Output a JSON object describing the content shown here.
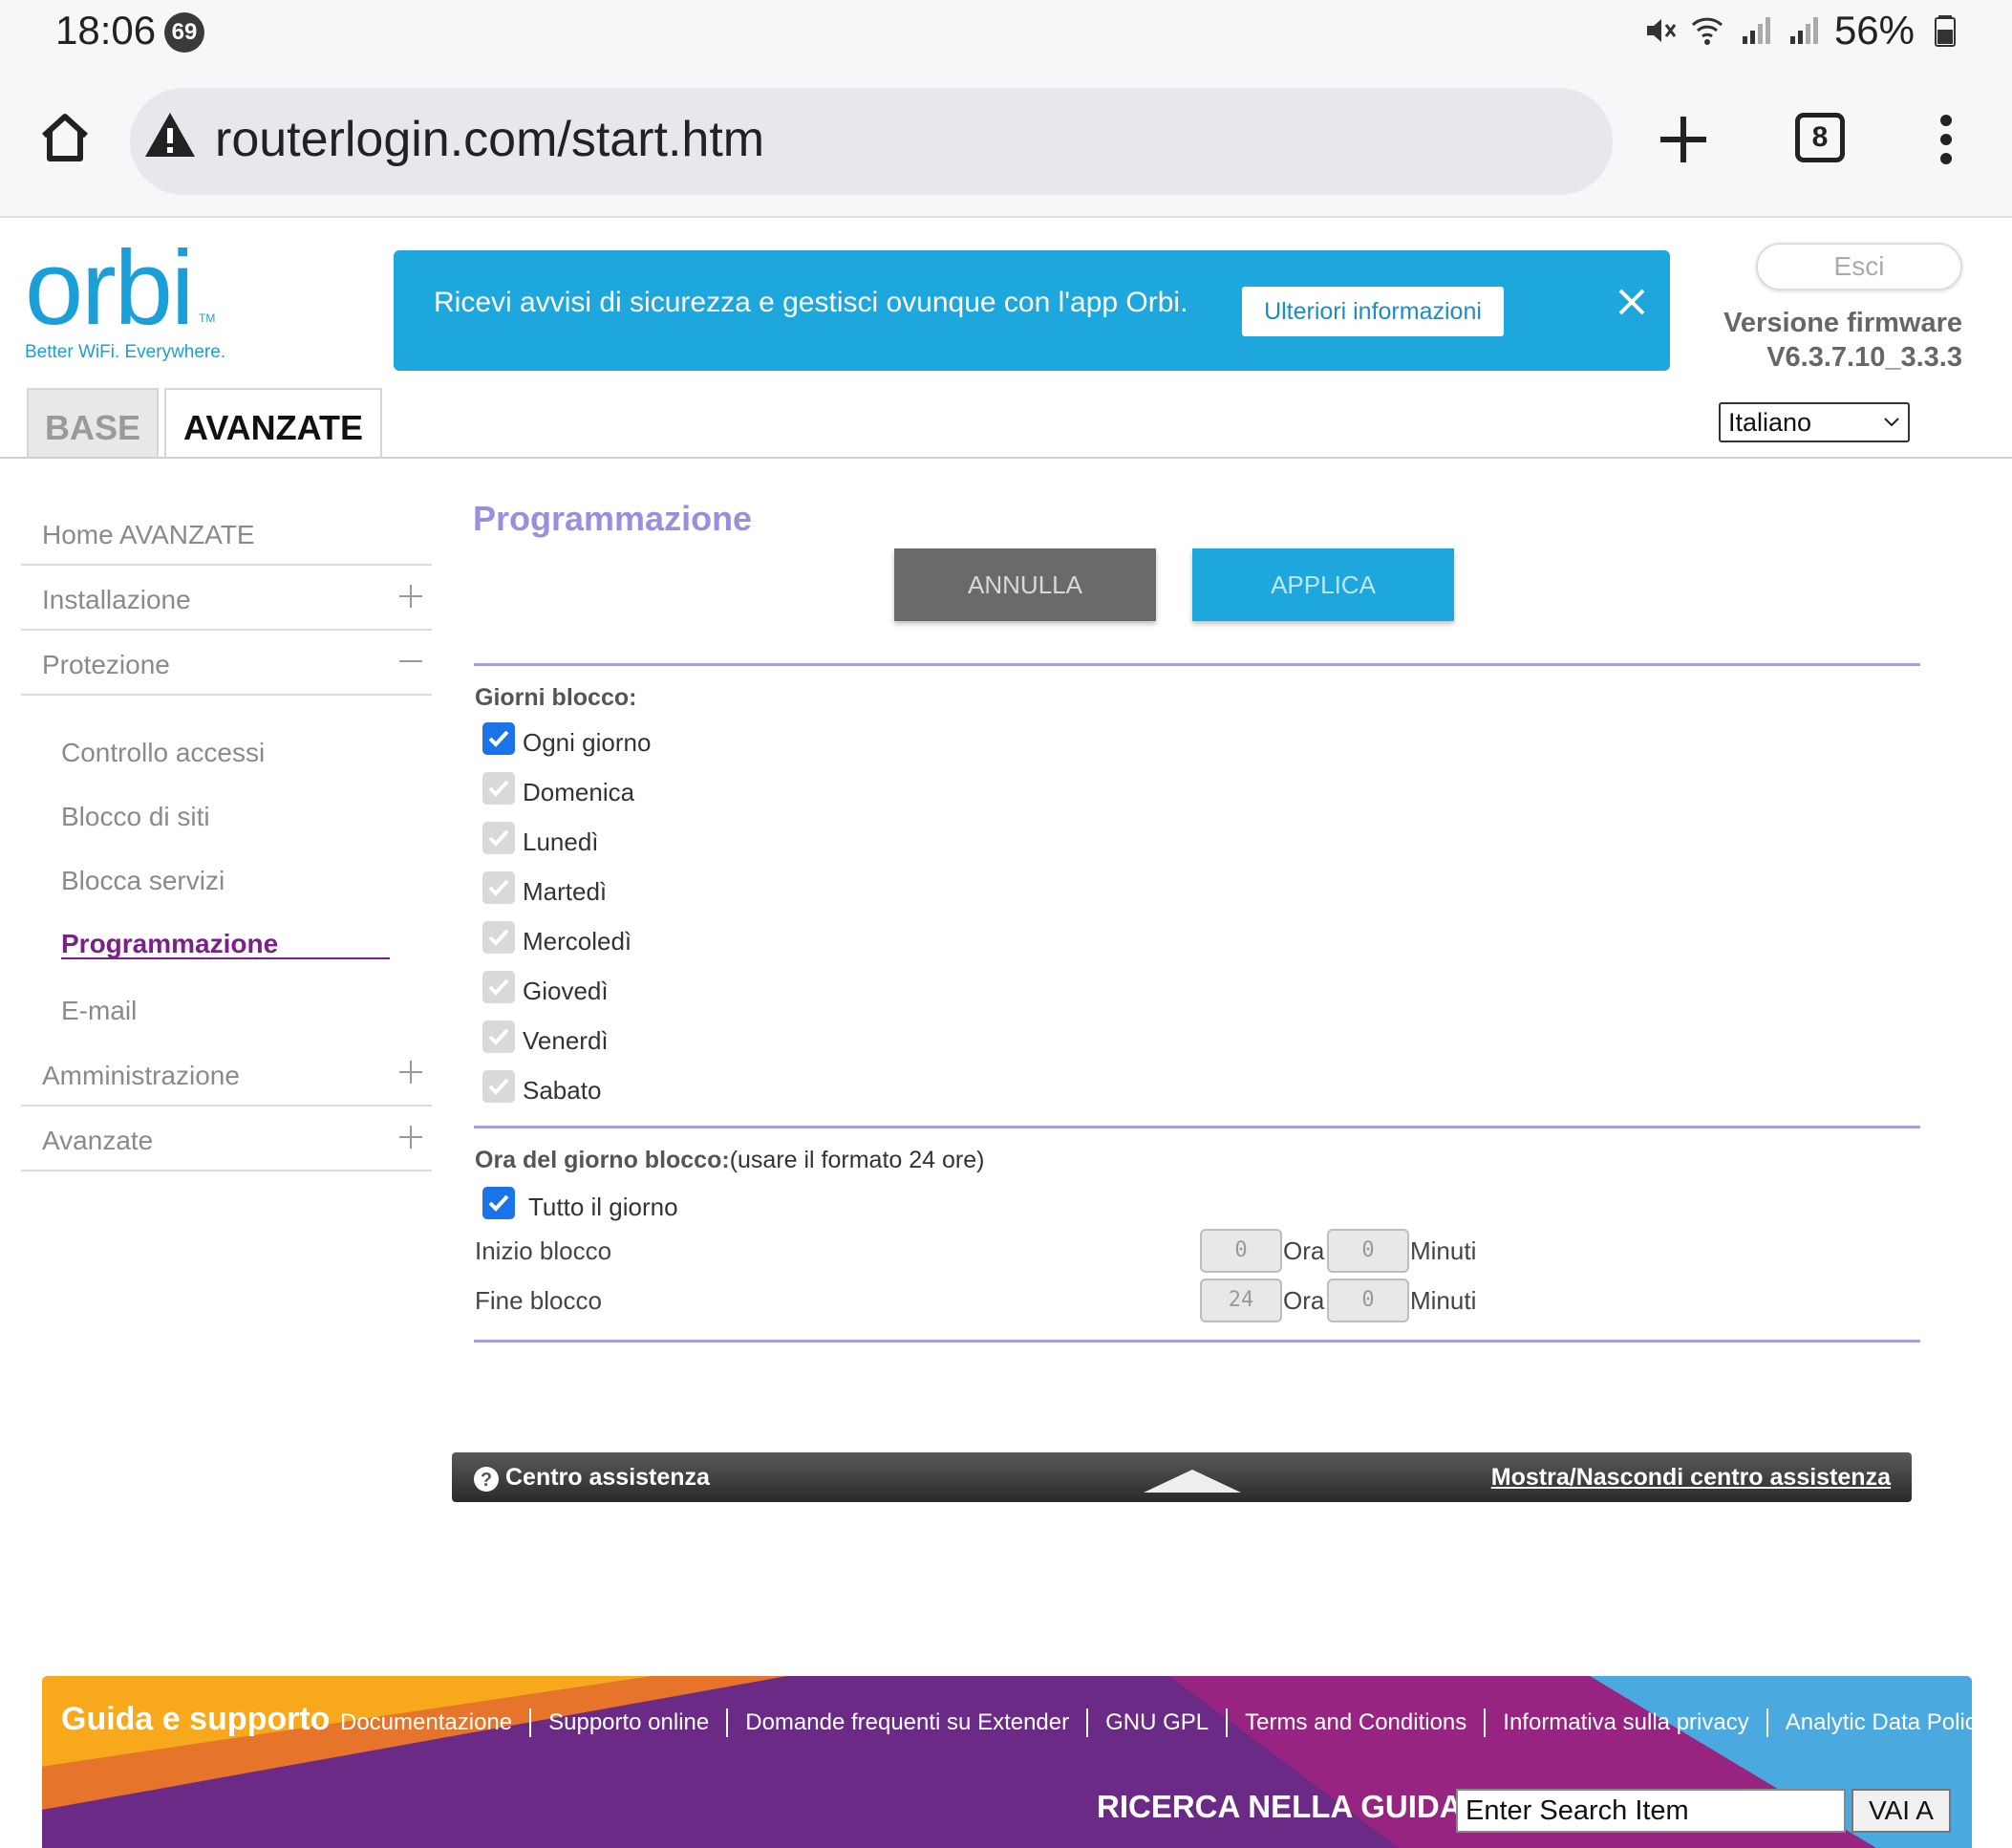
{
  "status_bar": {
    "time": "18:06",
    "notification_count": "69",
    "battery": "56%",
    "icons": [
      "mute-icon",
      "wifi-6e-icon",
      "signal-icon",
      "signal-icon",
      "battery-icon"
    ]
  },
  "browser": {
    "url": "routerlogin.com/start.htm",
    "tab_count": "8"
  },
  "header": {
    "logo_text": "orbi",
    "logo_tm": "TM",
    "logo_tagline": "Better WiFi. Everywhere.",
    "banner_text": "Ricevi avvisi di sicurezza e gestisci ovunque con l'app Orbi.",
    "banner_button": "Ulteriori informazioni",
    "logout": "Esci",
    "firmware_label": "Versione firmware",
    "firmware_version": "V6.3.7.10_3.3.3",
    "language": "Italiano"
  },
  "tabs": {
    "base": "BASE",
    "advanced": "AVANZATE"
  },
  "sidebar": {
    "items": [
      {
        "label": "Home AVANZATE"
      },
      {
        "label": "Installazione"
      },
      {
        "label": "Protezione"
      },
      {
        "label": "Amministrazione"
      },
      {
        "label": "Avanzate"
      }
    ],
    "sub_items": [
      {
        "label": "Controllo accessi"
      },
      {
        "label": "Blocco di siti"
      },
      {
        "label": "Blocca servizi"
      },
      {
        "label": "Programmazione"
      },
      {
        "label": "E-mail"
      }
    ]
  },
  "content": {
    "title": "Programmazione",
    "cancel": "ANNULLA",
    "apply": "APPLICA",
    "days_label": "Giorni blocco:",
    "days": [
      {
        "label": "Ogni giorno",
        "checked": true,
        "enabled": true
      },
      {
        "label": "Domenica",
        "checked": true,
        "enabled": false
      },
      {
        "label": "Lunedì",
        "checked": true,
        "enabled": false
      },
      {
        "label": "Martedì",
        "checked": true,
        "enabled": false
      },
      {
        "label": "Mercoledì",
        "checked": true,
        "enabled": false
      },
      {
        "label": "Giovedì",
        "checked": true,
        "enabled": false
      },
      {
        "label": "Venerdì",
        "checked": true,
        "enabled": false
      },
      {
        "label": "Sabato",
        "checked": true,
        "enabled": false
      }
    ],
    "time_label": "Ora del giorno blocco:",
    "time_note": "(usare il formato 24 ore)",
    "all_day": "Tutto il giorno",
    "start_label": "Inizio blocco",
    "end_label": "Fine blocco",
    "start_hour": "0",
    "start_min": "0",
    "end_hour": "24",
    "end_min": "0",
    "hour_unit": "Ora",
    "min_unit": "Minuti"
  },
  "help_center": {
    "title": "Centro assistenza",
    "toggle": "Mostra/Nascondi centro assistenza"
  },
  "footer": {
    "title": "Guida e supporto",
    "links": [
      "Documentazione",
      "Supporto online",
      "Domande frequenti su Extender",
      "GNU GPL",
      "Terms and Conditions",
      "Informativa sulla privacy",
      "Analytic Data Policy"
    ],
    "search_label": "RICERCA NELLA GUIDA",
    "search_value": "Enter Search Item",
    "search_button": "VAI A"
  },
  "colors": {
    "accent_blue": "#1da7dc",
    "title_purple": "#9a8fde",
    "active_purple": "#7b1f8c",
    "checkbox_blue": "#1a73e8"
  }
}
